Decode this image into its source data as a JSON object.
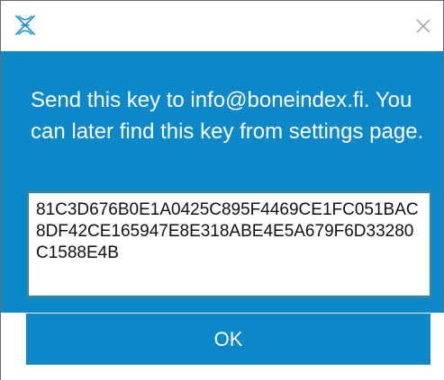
{
  "dialog": {
    "icon": "app-logo-icon",
    "close_icon": "close-icon",
    "message": "Send this key to info@boneindex.fi. You can later find this key from settings page.",
    "key_value": "81C3D676B0E1A0425C895F4469CE1FC051BAC8DF42CE165947E8E318ABE4E5A679F6D33280C1588E4B",
    "ok_label": "OK"
  },
  "colors": {
    "accent": "#0b88c8",
    "title_bar": "#ffffff",
    "text_on_accent": "#ffffff"
  }
}
